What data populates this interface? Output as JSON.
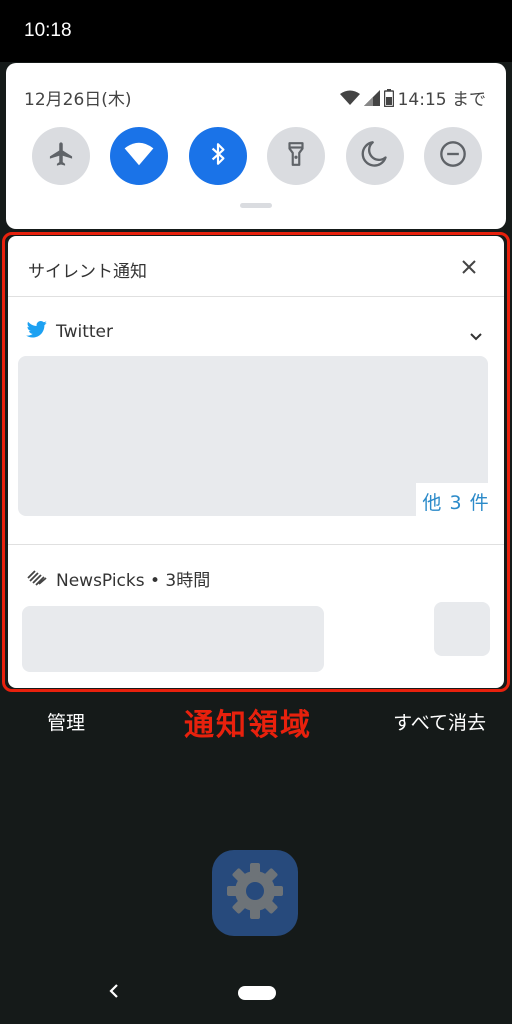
{
  "status_bar": {
    "time": "10:18"
  },
  "quick_settings": {
    "date": "12月26日(木)",
    "battery_until": "14:15 まで",
    "tiles": [
      {
        "name": "airplane-mode",
        "icon": "airplane-icon",
        "active": false
      },
      {
        "name": "wifi",
        "icon": "wifi-icon",
        "active": true
      },
      {
        "name": "bluetooth",
        "icon": "bluetooth-icon",
        "active": true
      },
      {
        "name": "flashlight",
        "icon": "flashlight-icon",
        "active": false
      },
      {
        "name": "night-light",
        "icon": "moon-icon",
        "active": false
      },
      {
        "name": "do-not-disturb",
        "icon": "dnd-icon",
        "active": false
      }
    ]
  },
  "notifications": {
    "section_title": "サイレント通知",
    "twitter": {
      "app_name": "Twitter",
      "more_count": "他 3 件"
    },
    "newspicks": {
      "app_name": "NewsPicks • 3時間"
    }
  },
  "actions": {
    "manage": "管理",
    "clear_all": "すべて消去"
  },
  "annotation": {
    "label": "通知領域",
    "color": "#e8210d"
  },
  "colors": {
    "accent": "#1a73e8",
    "twitter_blue": "#1da1f2",
    "link": "#2b8ac9"
  }
}
